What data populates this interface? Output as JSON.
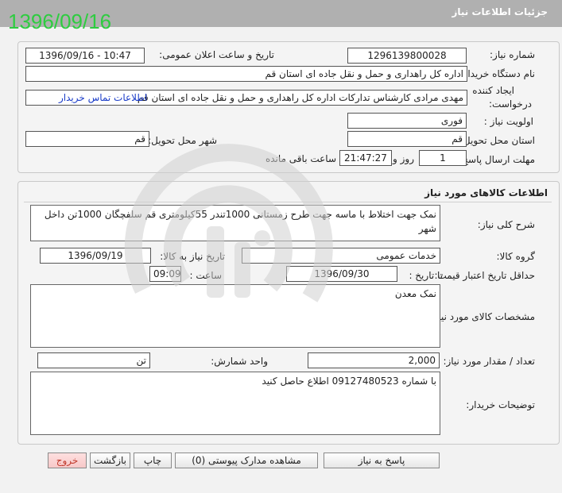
{
  "header": {
    "title": "جزئیات اطلاعات نیاز",
    "date_stamp": "1396/09/16"
  },
  "need": {
    "need_number_label": "شماره نیاز:",
    "need_number": "1296139800028",
    "announce_datetime_label": "تاریخ و ساعت اعلان عمومی:",
    "announce_datetime": "1396/09/16 - 10:47",
    "buyer_org_label": "نام دستگاه خریدار:",
    "buyer_org": "اداره کل راهداری و حمل و نقل جاده ای استان قم",
    "creator_label_1": "ایجاد کننده",
    "creator_label_2": "درخواست:",
    "creator": "مهدی مرادی کارشناس تدارکات اداره کل راهداری و حمل و نقل جاده ای استان قم",
    "contact_link": "اطلاعات تماس خریدار",
    "priority_label": "اولویت نیاز :",
    "priority": "فوری",
    "province_label": "استان محل تحویل:",
    "province": "قم",
    "city_label": "شهر محل تحویل:",
    "city": "قم",
    "deadline_label": "مهلت ارسال پاسخ:",
    "deadline_days": "1",
    "days_word": "روز و",
    "deadline_time": "21:47:27",
    "remaining_word": "ساعت باقی مانده"
  },
  "goods": {
    "section_title": "اطلاعات کالاهای مورد نیاز",
    "general_desc_label": "شرح کلی نیاز:",
    "general_desc": "نمک جهت اختلاط با ماسه جهت  طرح زمستانی 1000تندر 55کیلومتری قم سلفچگان 1000تن داخل شهر",
    "group_label": "گروه کالا:",
    "group": "خدمات عمومی",
    "need_date_label": "تاریخ نیاز به کالا:",
    "need_date": "1396/09/19",
    "min_price_label": "حداقل تاریخ اعتبار قیمت:",
    "until_date_label": "تا تاریخ :",
    "until_date": "1396/09/30",
    "time_label": "ساعت :",
    "time": "09:09",
    "spec_label": "مشخصات کالای مورد نیاز:",
    "spec": "نمک معدن",
    "qty_label": "تعداد / مقدار مورد نیاز:",
    "qty": "2,000",
    "unit_label": "واحد شمارش:",
    "unit": "تن",
    "buyer_notes_label": "توضیحات خریدار:",
    "buyer_notes": "با شماره 09127480523  اطلاع حاصل کنید"
  },
  "buttons": {
    "reply": "پاسخ به نیاز",
    "attachments": "مشاهده مدارک پیوستی (0)",
    "print": "چاپ",
    "back": "بازگشت",
    "exit": "خروج"
  }
}
